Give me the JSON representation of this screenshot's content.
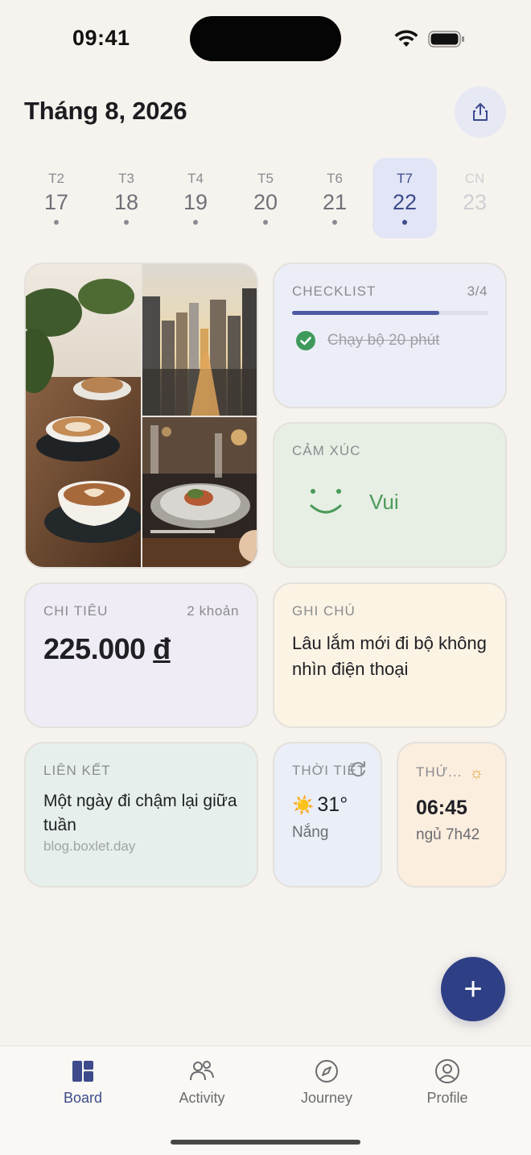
{
  "status_bar": {
    "time": "09:41"
  },
  "header": {
    "title": "Tháng 8, 2026",
    "share_icon": "share-icon"
  },
  "week": [
    {
      "dow": "T2",
      "date": "17",
      "has_entry": true,
      "state": "normal"
    },
    {
      "dow": "T3",
      "date": "18",
      "has_entry": true,
      "state": "normal"
    },
    {
      "dow": "T4",
      "date": "19",
      "has_entry": true,
      "state": "normal"
    },
    {
      "dow": "T5",
      "date": "20",
      "has_entry": true,
      "state": "normal"
    },
    {
      "dow": "T6",
      "date": "21",
      "has_entry": true,
      "state": "normal"
    },
    {
      "dow": "T7",
      "date": "22",
      "has_entry": true,
      "state": "selected"
    },
    {
      "dow": "CN",
      "date": "23",
      "has_entry": false,
      "state": "future"
    }
  ],
  "cards": {
    "checklist": {
      "label": "CHECKLIST",
      "count": "3/4",
      "progress": 0.75,
      "item": "Chạy bộ 20 phút",
      "item_done": true
    },
    "mood": {
      "label": "CẢM XÚC",
      "value": "Vui"
    },
    "spending": {
      "label": "CHI TIÊU",
      "count": "2 khoản",
      "amount": "225.000",
      "currency": "đ"
    },
    "note": {
      "label": "GHI CHÚ",
      "text": "Lâu lắm mới đi bộ không nhìn điện thoại"
    },
    "link": {
      "label": "LIÊN KẾT",
      "title": "Một ngày đi chậm lại giữa tuần",
      "url": "blog.boxlet.day"
    },
    "weather": {
      "label": "THỜI TIẾT",
      "temp": "31°",
      "condition": "Nắng"
    },
    "wake": {
      "label": "THỨ...",
      "time": "06:45",
      "sleep": "ngủ 7h42"
    }
  },
  "fab": {
    "label": "+"
  },
  "nav": [
    {
      "label": "Board",
      "icon": "board-icon",
      "active": true
    },
    {
      "label": "Activity",
      "icon": "activity-icon",
      "active": false
    },
    {
      "label": "Journey",
      "icon": "compass-icon",
      "active": false
    },
    {
      "label": "Profile",
      "icon": "profile-icon",
      "active": false
    }
  ],
  "colors": {
    "accent": "#2f3f85",
    "selected_day": "#e1e5f5",
    "mood_green": "#4b9a59",
    "background": "#f6f3ee"
  }
}
